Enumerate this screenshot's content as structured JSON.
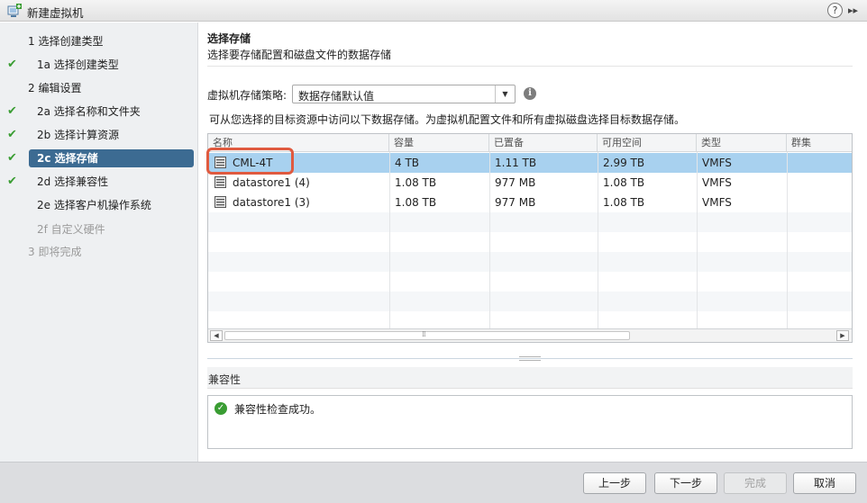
{
  "window": {
    "title": "新建虚拟机",
    "help_glyph": "?",
    "expand_glyph": "▸▸"
  },
  "wizard": {
    "steps": [
      {
        "label": "1  选择创建类型",
        "checked": false,
        "state": "normal"
      },
      {
        "label": "1a  选择创建类型",
        "checked": true,
        "state": "normal"
      },
      {
        "label": "2  编辑设置",
        "checked": false,
        "state": "normal"
      },
      {
        "label": "2a  选择名称和文件夹",
        "checked": true,
        "state": "normal"
      },
      {
        "label": "2b  选择计算资源",
        "checked": true,
        "state": "normal"
      },
      {
        "label": "2c  选择存储",
        "checked": true,
        "state": "selected"
      },
      {
        "label": "2d  选择兼容性",
        "checked": true,
        "state": "normal"
      },
      {
        "label": "2e  选择客户机操作系统",
        "checked": false,
        "state": "normal"
      },
      {
        "label": "2f  自定义硬件",
        "checked": false,
        "state": "disabled"
      },
      {
        "label": "3  即将完成",
        "checked": false,
        "state": "disabled"
      }
    ],
    "check_glyph": "✔"
  },
  "storage": {
    "title": "选择存储",
    "description": "选择要存储配置和磁盘文件的数据存储",
    "policy_label": "虚拟机存储策略:",
    "policy_value": "数据存储默认值",
    "hint": "可从您选择的目标资源中访问以下数据存储。为虚拟机配置文件和所有虚拟磁盘选择目标数据存储。",
    "columns": [
      "名称",
      "容量",
      "已置备",
      "可用空间",
      "类型",
      "群集"
    ],
    "rows": [
      {
        "name": "CML-4T",
        "capacity": "4 TB",
        "provisioned": "1.11 TB",
        "free": "2.99 TB",
        "type": "VMFS",
        "cluster": "",
        "selected": true
      },
      {
        "name": "datastore1 (4)",
        "capacity": "1.08 TB",
        "provisioned": "977 MB",
        "free": "1.08 TB",
        "type": "VMFS",
        "cluster": "",
        "selected": false
      },
      {
        "name": "datastore1 (3)",
        "capacity": "1.08 TB",
        "provisioned": "977 MB",
        "free": "1.08 TB",
        "type": "VMFS",
        "cluster": "",
        "selected": false
      }
    ],
    "highlight_color": "#e05a3f"
  },
  "compatibility": {
    "title": "兼容性",
    "message": "兼容性检查成功。",
    "status_color": "#3a9d33"
  },
  "footer": {
    "back": "上一步",
    "next": "下一步",
    "finish": "完成",
    "cancel": "取消"
  },
  "colors": {
    "selected_step": "#3c6b92",
    "selected_row": "#a8d1ef"
  }
}
